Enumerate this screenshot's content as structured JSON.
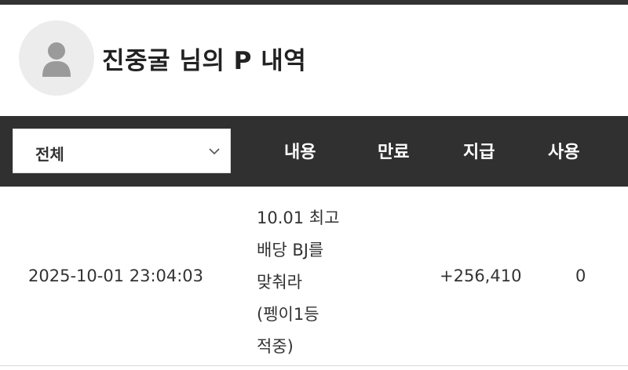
{
  "profile": {
    "title": "진중굴 님의 P 내역",
    "avatar_icon": "user-icon"
  },
  "filter": {
    "selected": "전체",
    "icon": "chevron-down-icon"
  },
  "columns": {
    "content": "내용",
    "expire": "만료",
    "pay": "지급",
    "use": "사용"
  },
  "rows": [
    {
      "datetime": "2025-10-01 23:04:03",
      "content": "10.01 최고 배당 BJ를 맞춰라 (펭이1등 적중)",
      "pay": "+256,410",
      "use": "0"
    }
  ]
}
